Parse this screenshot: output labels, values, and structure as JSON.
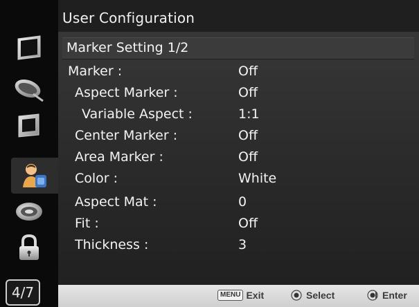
{
  "header": {
    "title": "User Configuration"
  },
  "section": {
    "title": "Marker Setting 1/2"
  },
  "settings": [
    {
      "label": "Marker :",
      "value": "Off"
    },
    {
      "label": "Aspect Marker :",
      "value": "Off"
    },
    {
      "label": "Variable Aspect :",
      "value": "1:1"
    },
    {
      "label": "Center Marker :",
      "value": "Off"
    },
    {
      "label": "Area Marker :",
      "value": "Off"
    },
    {
      "label": "Color :",
      "value": "White"
    },
    {
      "label": "Aspect Mat :",
      "value": "0"
    },
    {
      "label": "Fit :",
      "value": "Off"
    },
    {
      "label": "Thickness :",
      "value": "3"
    }
  ],
  "sidebar": {
    "icons": [
      {
        "name": "monitor-icon"
      },
      {
        "name": "satellite-dish-icon"
      },
      {
        "name": "display-panel-icon"
      },
      {
        "name": "user-icon",
        "active": true
      },
      {
        "name": "network-icon"
      },
      {
        "name": "lock-icon"
      }
    ],
    "page_indicator": "4/7"
  },
  "footer": {
    "menu_key": "MENU",
    "exit_label": "Exit",
    "select_label": "Select",
    "enter_label": "Enter"
  },
  "colors": {
    "background": "#2a2a2a",
    "sidebar": "#0a0a0a",
    "header": "#1f1f1f",
    "text": "#f3f3f3",
    "footer": "#d8d8d8"
  }
}
